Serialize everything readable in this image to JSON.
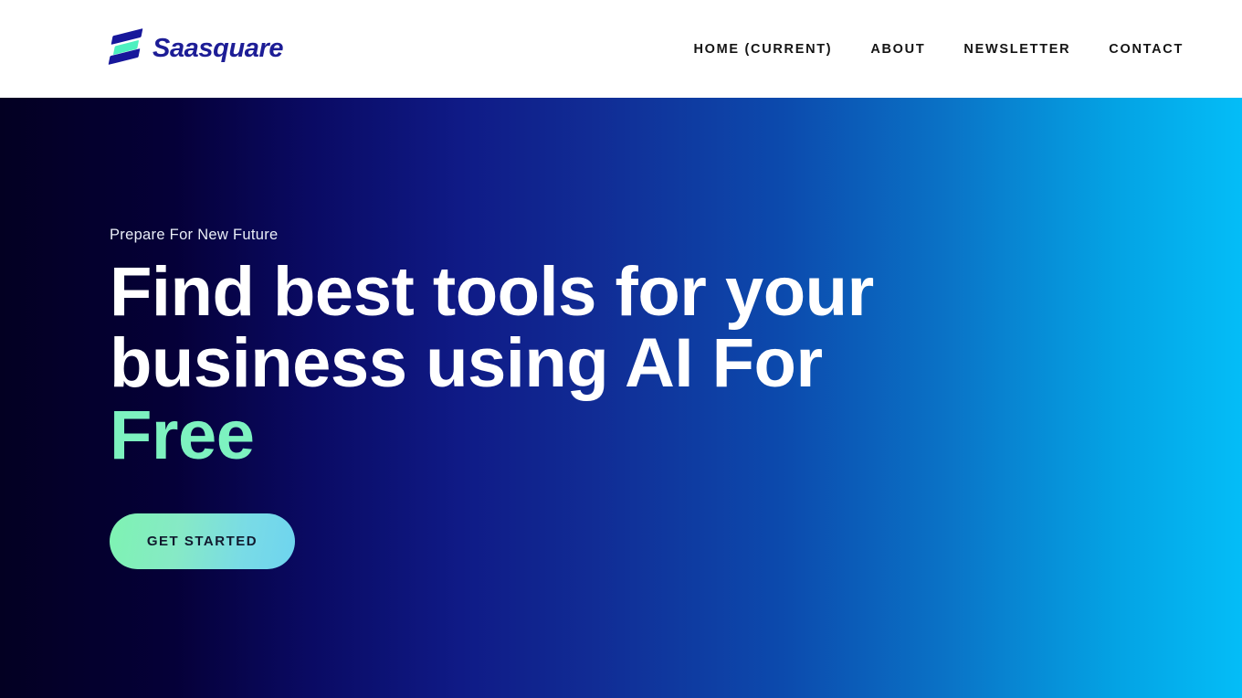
{
  "header": {
    "brand": {
      "name": "Saasquare",
      "mark_colors": {
        "navy": "#17179b",
        "mint": "#4ef0c0"
      }
    },
    "nav": [
      {
        "label": "HOME (CURRENT)",
        "active": true
      },
      {
        "label": "ABOUT",
        "active": false
      },
      {
        "label": "NEWSLETTER",
        "active": false
      },
      {
        "label": "CONTACT",
        "active": false
      }
    ]
  },
  "hero": {
    "eyebrow": "Prepare For New Future",
    "title_line1": "Find best tools for your",
    "title_line2": "business using AI For",
    "title_accent": "Free",
    "cta_label": "GET STARTED",
    "colors": {
      "gradient_start": "#030022",
      "gradient_mid": "#112c95",
      "gradient_end": "#04bdf7",
      "accent_text": "#7df2c0",
      "cta_gradient_start": "#7ef3b2",
      "cta_gradient_end": "#6ed4ef",
      "cta_text": "#111a2e"
    }
  }
}
